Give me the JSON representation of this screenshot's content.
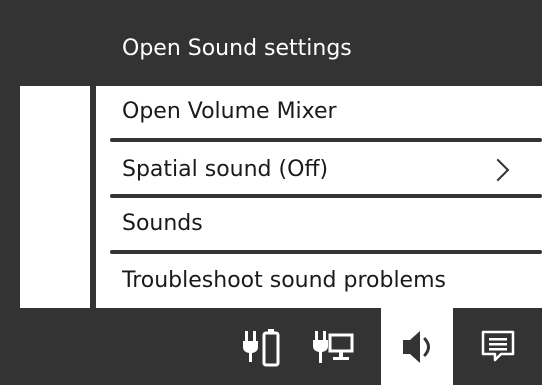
{
  "header": {
    "title": "Open Sound settings"
  },
  "menu": {
    "items": [
      {
        "label": "Open Volume Mixer"
      },
      {
        "label": "Spatial sound (Off)",
        "has_submenu": true
      },
      {
        "label": "Sounds"
      },
      {
        "label": "Troubleshoot sound problems"
      }
    ]
  },
  "taskbar": {
    "icons": [
      {
        "name": "battery-plug-icon"
      },
      {
        "name": "network-plug-icon"
      },
      {
        "name": "speaker-icon",
        "active": true
      },
      {
        "name": "notification-icon"
      }
    ]
  },
  "colors": {
    "frame": "#333333",
    "menu_bg": "#ffffff",
    "text": "#1a1a1a",
    "header_text": "#ffffff"
  }
}
